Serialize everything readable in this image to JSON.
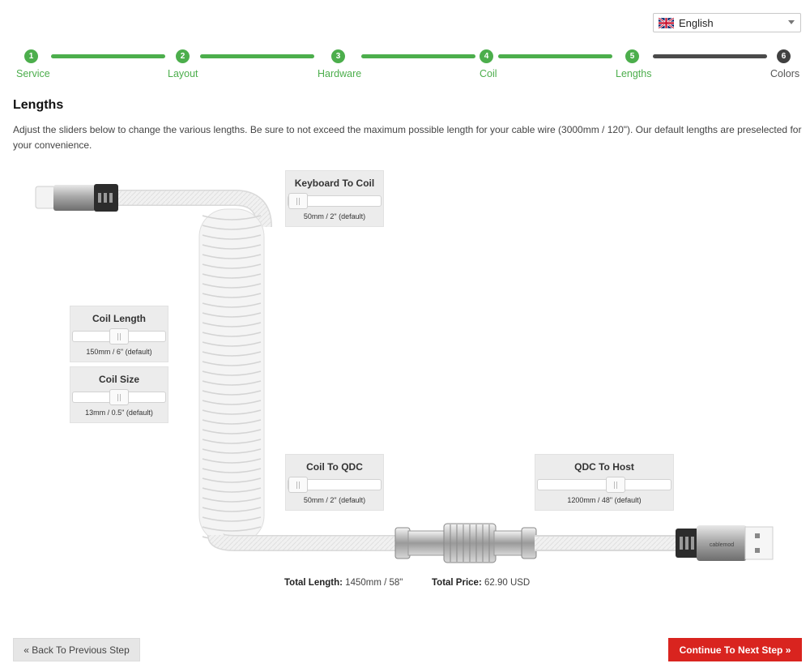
{
  "language": {
    "selected": "English"
  },
  "stepper": {
    "steps": [
      {
        "num": "1",
        "label": "Service"
      },
      {
        "num": "2",
        "label": "Layout"
      },
      {
        "num": "3",
        "label": "Hardware"
      },
      {
        "num": "4",
        "label": "Coil"
      },
      {
        "num": "5",
        "label": "Lengths"
      },
      {
        "num": "6",
        "label": "Colors"
      }
    ],
    "active_color": "#4cae4c",
    "inactive_color": "#404040"
  },
  "page": {
    "title": "Lengths",
    "description": "Adjust the sliders below to change the various lengths. Be sure to not exceed the maximum possible length for your cable wire (3000mm / 120\"). Our default lengths are preselected for your convenience."
  },
  "sliders": {
    "keyboard_to_coil": {
      "title": "Keyboard To Coil",
      "value": "50mm / 2\" (default)",
      "level": 0.0
    },
    "coil_length": {
      "title": "Coil Length",
      "value": "150mm / 6\" (default)",
      "level": 0.5
    },
    "coil_size": {
      "title": "Coil Size",
      "value": "13mm / 0.5\" (default)",
      "level": 0.5
    },
    "coil_to_qdc": {
      "title": "Coil To QDC",
      "value": "50mm / 2\" (default)",
      "level": 0.0
    },
    "qdc_to_host": {
      "title": "QDC To Host",
      "value": "1200mm / 48\" (default)",
      "level": 0.6
    }
  },
  "totals": {
    "length_label": "Total Length:",
    "length_value": "1450mm / 58\"",
    "price_label": "Total Price:",
    "price_value": "62.90 USD"
  },
  "connector_brand": "cablemod",
  "buttons": {
    "back": "« Back To Previous Step",
    "next": "Continue To Next Step »"
  },
  "colors": {
    "accent_red": "#d9241f",
    "accent_green": "#4cae4c"
  }
}
